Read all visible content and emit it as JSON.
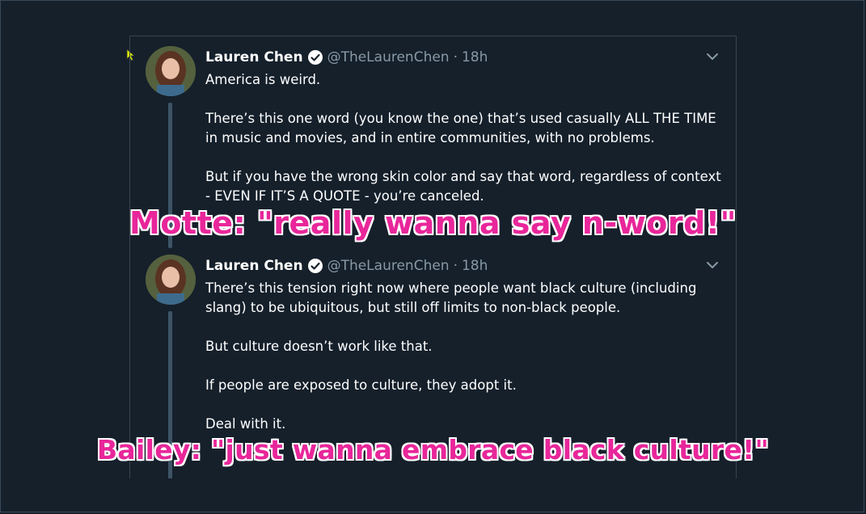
{
  "tweets": [
    {
      "name": "Lauren Chen",
      "handle": "@TheLaurenChen",
      "separator": "·",
      "time": "18h",
      "paragraphs": [
        "America is weird.",
        "There’s this one word (you know the one) that’s used casually ALL THE TIME in music and movies, and in entire communities, with no problems.",
        "But if you have the wrong skin color and say that word, regardless of context - EVEN IF IT’S A QUOTE - you’re canceled."
      ]
    },
    {
      "name": "Lauren Chen",
      "handle": "@TheLaurenChen",
      "separator": "·",
      "time": "18h",
      "paragraphs": [
        "There’s this tension right now where people want black culture (including slang) to be ubiquitous, but still off limits to non-black people.",
        "But culture doesn’t work like that.",
        "If people are exposed to culture, they adopt it.",
        "Deal with it."
      ]
    }
  ],
  "overlays": {
    "motte": "Motte: \"really wanna say n-word!\"",
    "bailey": "Bailey: \"just wanna embrace black culture!\""
  },
  "colors": {
    "background": "#15202b",
    "overlay_fill": "#e8269a",
    "overlay_outline": "#ffffff",
    "verified": "#ffffff",
    "handle": "#8899a6"
  },
  "icons": [
    "cursor-icon",
    "verified-icon",
    "chevron-down-icon"
  ]
}
